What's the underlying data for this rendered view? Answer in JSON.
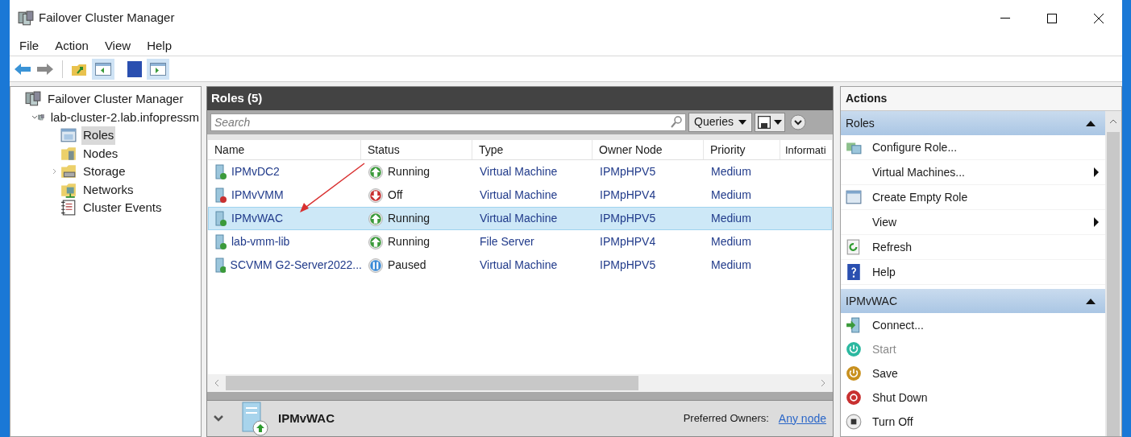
{
  "window": {
    "title": "Failover Cluster Manager"
  },
  "menu": [
    "File",
    "Action",
    "View",
    "Help"
  ],
  "tree": [
    {
      "label": "Failover Cluster Manager",
      "selected": false,
      "children": [
        {
          "label": "lab-cluster-2.lab.infopressm",
          "selected": false,
          "expanded": true,
          "children": [
            {
              "label": "Roles",
              "selected": true
            },
            {
              "label": "Nodes",
              "selected": false
            },
            {
              "label": "Storage",
              "selected": false,
              "expanded": false
            },
            {
              "label": "Networks",
              "selected": false
            },
            {
              "label": "Cluster Events",
              "selected": false
            }
          ]
        }
      ]
    }
  ],
  "roles_panel": {
    "title": "Roles (5)",
    "search": {
      "placeholder": "Search"
    },
    "queries_button": "Queries",
    "columns": [
      "Name",
      "Status",
      "Type",
      "Owner Node",
      "Priority",
      "Informati"
    ],
    "rows": [
      {
        "name": "IPMvDC2",
        "status": "Running",
        "kind": "running",
        "type": "Virtual Machine",
        "owner_node": "IPMpHPV5",
        "priority": "Medium",
        "selected": false
      },
      {
        "name": "IPMvVMM",
        "status": "Off",
        "kind": "off",
        "type": "Virtual Machine",
        "owner_node": "IPMpHPV4",
        "priority": "Medium",
        "selected": false
      },
      {
        "name": "IPMvWAC",
        "status": "Running",
        "kind": "running",
        "type": "Virtual Machine",
        "owner_node": "IPMpHPV5",
        "priority": "Medium",
        "selected": true
      },
      {
        "name": "lab-vmm-lib",
        "status": "Running",
        "kind": "running",
        "type": "File Server",
        "owner_node": "IPMpHPV4",
        "priority": "Medium",
        "selected": false
      },
      {
        "name": "SCVMM G2-Server2022...",
        "status": "Paused",
        "kind": "paused",
        "type": "Virtual Machine",
        "owner_node": "IPMpHPV5",
        "priority": "Medium",
        "selected": false
      }
    ]
  },
  "details": {
    "title": "IPMvWAC",
    "preferred_owners_label": "Preferred Owners:",
    "preferred_owners_link": "Any node"
  },
  "actions": {
    "title": "Actions",
    "sections": [
      {
        "title": "Roles",
        "items": [
          {
            "label": "Configure Role...",
            "submenu": false,
            "disabled": false
          },
          {
            "label": "Virtual Machines...",
            "submenu": true,
            "disabled": false
          },
          {
            "label": "Create Empty Role",
            "submenu": false,
            "disabled": false
          },
          {
            "label": "View",
            "submenu": true,
            "disabled": false
          },
          {
            "label": "Refresh",
            "submenu": false,
            "disabled": false
          },
          {
            "label": "Help",
            "submenu": false,
            "disabled": false
          }
        ]
      },
      {
        "title": "IPMvWAC",
        "items": [
          {
            "label": "Connect...",
            "submenu": false,
            "disabled": false
          },
          {
            "label": "Start",
            "submenu": false,
            "disabled": true
          },
          {
            "label": "Save",
            "submenu": false,
            "disabled": false
          },
          {
            "label": "Shut Down",
            "submenu": false,
            "disabled": false
          },
          {
            "label": "Turn Off",
            "submenu": false,
            "disabled": false
          }
        ]
      }
    ]
  }
}
